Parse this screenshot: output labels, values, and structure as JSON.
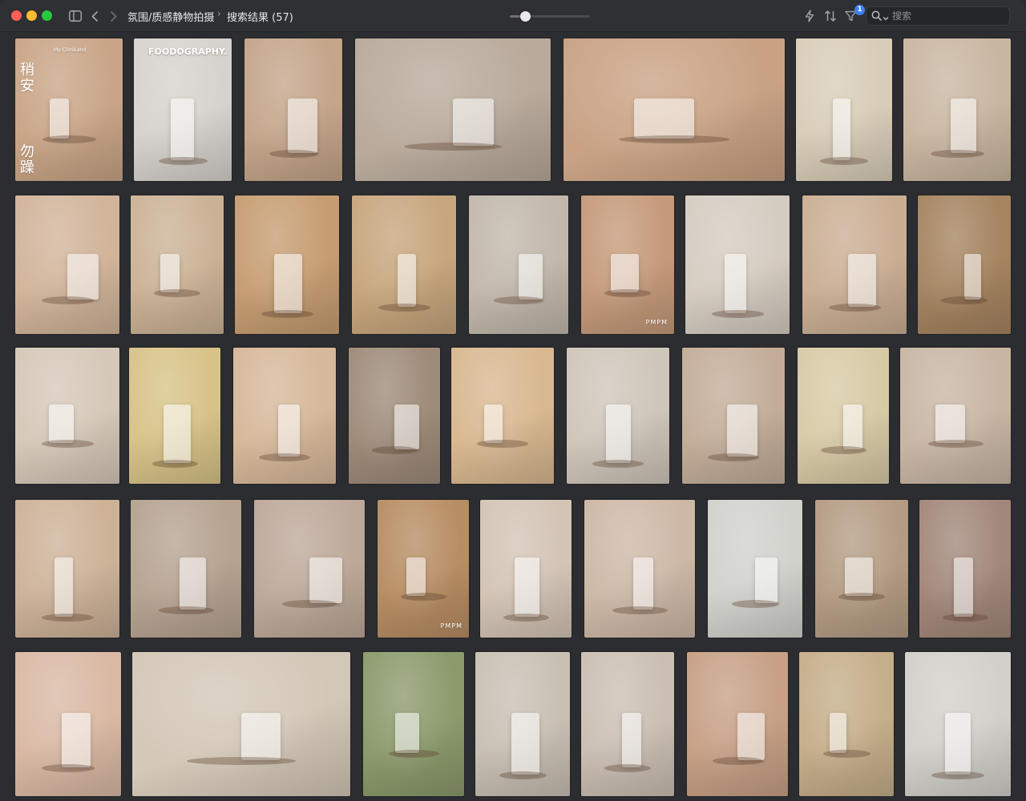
{
  "window": {
    "breadcrumb": [
      "氛围/质感静物拍摄",
      "搜索结果 (57)"
    ],
    "zoom_level": 0.15
  },
  "toolbar": {
    "filter_badge": "1",
    "search_placeholder": "搜索"
  },
  "thumbnails": [
    {
      "color": "#c9a587",
      "overlay_texts": [
        "My ClimiLand",
        "稍安",
        "勿躁"
      ]
    },
    {
      "color": "#d6d2cc",
      "overlay_texts": [
        "FOODOGRAPHY."
      ]
    },
    {
      "color": "#c4a58a",
      "overlay_texts": []
    },
    {
      "color": "#b9aa9b",
      "overlay_texts": []
    },
    {
      "color": "#c9a284",
      "overlay_texts": []
    },
    {
      "color": "#d8cdb8",
      "overlay_texts": []
    },
    {
      "color": "#c9b6a1",
      "overlay_texts": []
    },
    {
      "color": "#d1b49a",
      "overlay_texts": []
    },
    {
      "color": "#cbb296",
      "overlay_texts": []
    },
    {
      "color": "#c69d72",
      "overlay_texts": []
    },
    {
      "color": "#c7a67d",
      "overlay_texts": []
    },
    {
      "color": "#c2b8ab",
      "overlay_texts": []
    },
    {
      "color": "#c59a7a",
      "overlay_texts": [
        "PMPM"
      ]
    },
    {
      "color": "#d5ccc1",
      "overlay_texts": []
    },
    {
      "color": "#caae94",
      "overlay_texts": []
    },
    {
      "color": "#a58460",
      "overlay_texts": []
    },
    {
      "color": "#d5c8b8",
      "overlay_texts": []
    },
    {
      "color": "#d7c388",
      "overlay_texts": []
    },
    {
      "color": "#d6b89a",
      "overlay_texts": []
    },
    {
      "color": "#9e8b79",
      "overlay_texts": []
    },
    {
      "color": "#d8b890",
      "overlay_texts": []
    },
    {
      "color": "#cfc6ba",
      "overlay_texts": []
    },
    {
      "color": "#c3ad99",
      "overlay_texts": []
    },
    {
      "color": "#d8caa6",
      "overlay_texts": []
    },
    {
      "color": "#c8b6a4",
      "overlay_texts": []
    },
    {
      "color": "#cdb298",
      "overlay_texts": []
    },
    {
      "color": "#b6a391",
      "overlay_texts": []
    },
    {
      "color": "#bda999",
      "overlay_texts": []
    },
    {
      "color": "#b78d63",
      "overlay_texts": [
        "PMPM"
      ]
    },
    {
      "color": "#d3c4b5",
      "overlay_texts": []
    },
    {
      "color": "#cdb8a6",
      "overlay_texts": []
    },
    {
      "color": "#d1d2cc",
      "overlay_texts": []
    },
    {
      "color": "#b49c84",
      "overlay_texts": []
    },
    {
      "color": "#a2887a",
      "overlay_texts": []
    },
    {
      "color": "#d9b9a4",
      "overlay_texts": []
    },
    {
      "color": "#d3c7b7",
      "overlay_texts": []
    },
    {
      "color": "#8c9a6c",
      "overlay_texts": []
    },
    {
      "color": "#c9c0b4",
      "overlay_texts": []
    },
    {
      "color": "#cbbfb3",
      "overlay_texts": []
    },
    {
      "color": "#c7a086",
      "overlay_texts": []
    },
    {
      "color": "#c5ae8a",
      "overlay_texts": []
    },
    {
      "color": "#d2d0ca",
      "overlay_texts": []
    }
  ]
}
